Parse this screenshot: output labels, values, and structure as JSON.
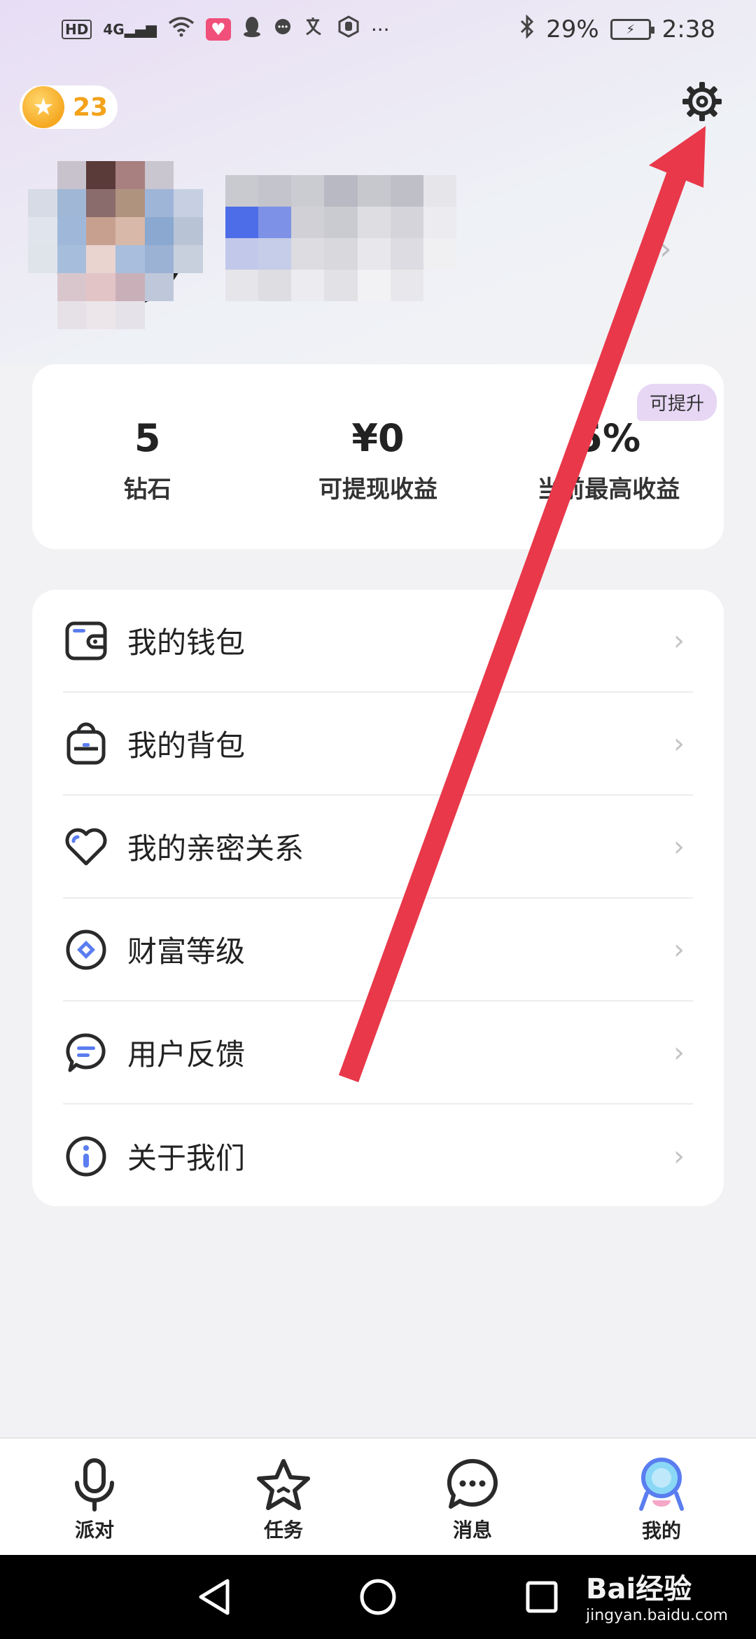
{
  "status_bar": {
    "left_badge": "HD",
    "network": "4G",
    "battery_percent": "29%",
    "time": "2:38"
  },
  "coins": {
    "count": "23"
  },
  "stats": [
    {
      "value": "5",
      "label": "钻石"
    },
    {
      "value": "¥0",
      "label": "可提现收益"
    },
    {
      "value": "5%",
      "label": "当前最高收益"
    }
  ],
  "upgrade_badge": "可提升",
  "menu": [
    {
      "label": "我的钱包",
      "icon": "wallet-icon"
    },
    {
      "label": "我的背包",
      "icon": "backpack-icon"
    },
    {
      "label": "我的亲密关系",
      "icon": "heart-icon"
    },
    {
      "label": "财富等级",
      "icon": "wealth-level-icon"
    },
    {
      "label": "用户反馈",
      "icon": "feedback-icon"
    },
    {
      "label": "关于我们",
      "icon": "info-icon"
    }
  ],
  "tabs": [
    {
      "label": "派对",
      "icon": "microphone-icon",
      "active": false
    },
    {
      "label": "任务",
      "icon": "star-icon",
      "active": false
    },
    {
      "label": "消息",
      "icon": "message-icon",
      "active": false
    },
    {
      "label": "我的",
      "icon": "profile-icon",
      "active": true
    }
  ],
  "watermark": {
    "brand": "Bai经验",
    "url": "jingyan.baidu.com"
  },
  "colors": {
    "coin": "#f3a21a",
    "accent_blue": "#5a7df0",
    "arrow_red": "#e8384a",
    "badge_purple": "#e7d7f5"
  }
}
